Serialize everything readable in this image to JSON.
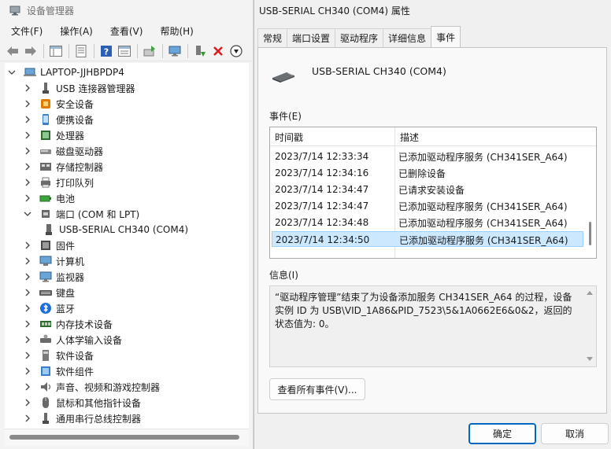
{
  "device_manager": {
    "title": "设备管理器",
    "menu": [
      "文件(F)",
      "操作(A)",
      "查看(V)",
      "帮助(H)"
    ],
    "tree": {
      "root": "LAPTOP-JJHBPDP4",
      "items": [
        {
          "label": "USB 连接器管理器",
          "icon": "usb-connector-icon"
        },
        {
          "label": "安全设备",
          "icon": "security-device-icon"
        },
        {
          "label": "便携设备",
          "icon": "portable-device-icon"
        },
        {
          "label": "处理器",
          "icon": "processor-icon"
        },
        {
          "label": "磁盘驱动器",
          "icon": "disk-drive-icon"
        },
        {
          "label": "存储控制器",
          "icon": "storage-controller-icon"
        },
        {
          "label": "打印队列",
          "icon": "print-queue-icon"
        },
        {
          "label": "电池",
          "icon": "battery-icon"
        },
        {
          "label": "端口 (COM 和 LPT)",
          "icon": "port-icon",
          "expanded": true
        },
        {
          "label": "USB-SERIAL CH340 (COM4)",
          "icon": "serial-port-icon",
          "child": true
        },
        {
          "label": "固件",
          "icon": "firmware-icon"
        },
        {
          "label": "计算机",
          "icon": "computer-icon"
        },
        {
          "label": "监视器",
          "icon": "monitor-icon"
        },
        {
          "label": "键盘",
          "icon": "keyboard-icon"
        },
        {
          "label": "蓝牙",
          "icon": "bluetooth-icon"
        },
        {
          "label": "内存技术设备",
          "icon": "memory-device-icon"
        },
        {
          "label": "人体学输入设备",
          "icon": "hid-icon"
        },
        {
          "label": "软件设备",
          "icon": "software-device-icon"
        },
        {
          "label": "软件组件",
          "icon": "software-component-icon"
        },
        {
          "label": "声音、视频和游戏控制器",
          "icon": "sound-icon"
        },
        {
          "label": "鼠标和其他指针设备",
          "icon": "mouse-icon"
        },
        {
          "label": "通用串行总线控制器",
          "icon": "usb-controller-icon"
        }
      ]
    }
  },
  "properties": {
    "title": "USB-SERIAL CH340 (COM4) 属性",
    "tabs": [
      "常规",
      "端口设置",
      "驱动程序",
      "详细信息",
      "事件"
    ],
    "active_tab": "事件",
    "device_name": "USB-SERIAL CH340 (COM4)",
    "events_label": "事件(E)",
    "columns": {
      "timestamp": "时间戳",
      "description": "描述"
    },
    "events": [
      {
        "time": "2023/7/14 12:33:34",
        "desc": "已添加驱动程序服务 (CH341SER_A64)"
      },
      {
        "time": "2023/7/14 12:34:16",
        "desc": "已删除设备"
      },
      {
        "time": "2023/7/14 12:34:47",
        "desc": "已请求安装设备"
      },
      {
        "time": "2023/7/14 12:34:47",
        "desc": "已添加驱动程序服务 (CH341SER_A64)"
      },
      {
        "time": "2023/7/14 12:34:48",
        "desc": "已添加驱动程序服务 (CH341SER_A64)"
      },
      {
        "time": "2023/7/14 12:34:50",
        "desc": "已添加驱动程序服务 (CH341SER_A64)",
        "selected": true
      }
    ],
    "info_label": "信息(I)",
    "info_text": "“驱动程序管理”结束了为设备添加服务 CH341SER_A64 的过程，设备实例 ID 为 USB\\VID_1A86&PID_7523\\5&1A0662E6&0&2，返回的状态值为: 0。",
    "view_all_label": "查看所有事件(V)...",
    "ok_label": "确定",
    "cancel_label": "取消"
  },
  "colors": {
    "accent": "#0067c0",
    "selection": "#cce8ff",
    "selection_border": "#99d1ff"
  }
}
